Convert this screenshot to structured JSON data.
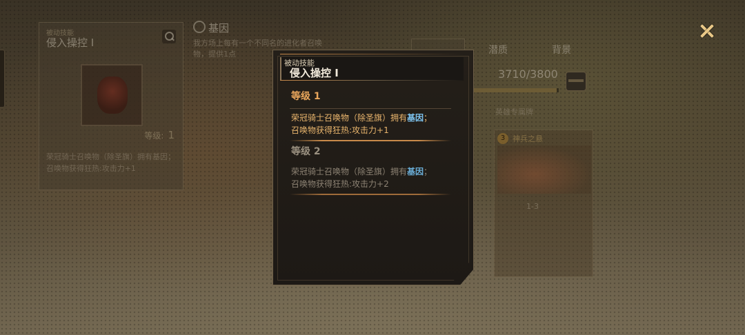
{
  "background": {
    "skill_card": {
      "category": "被动技能",
      "name": "侵入操控 I",
      "level_label": "等级:",
      "level_value": "1",
      "description": "荣冠骑士召唤物（除圣旗）拥有基因；召唤物获得狂热:攻击力+1"
    },
    "gene": {
      "title": "基因",
      "description": "我方场上每有一个不同名的进化者召唤物，提供1点"
    },
    "tabs": [
      "潜质",
      "背景"
    ],
    "exp": {
      "text": "3710/3800",
      "current": 3710,
      "max": 3800
    },
    "gear_caption": "英雄专属牌",
    "gear_card": {
      "cost": "3",
      "name": "神兵之悬",
      "ratio": "1-3"
    }
  },
  "close_icon": "close-icon",
  "tooltip": {
    "category": "被动技能",
    "title": "侵入操控 I",
    "levels": [
      {
        "header": "等级 1",
        "line1_pre": "荣冠骑士召唤物（除圣旗）拥有",
        "line1_kw": "基因",
        "line1_post": "；",
        "line2": "召唤物获得狂热:攻击力+1"
      },
      {
        "header": "等级 2",
        "line1_pre": "荣冠骑士召唤物（除圣旗）拥有",
        "line1_kw": "基因",
        "line1_post": "；",
        "line2": "召唤物获得狂热:攻击力+2"
      }
    ]
  },
  "colors": {
    "active_level": "#e9a65c",
    "inactive_level": "#9a9080",
    "keyword": "#7ec4f0",
    "close": "#e9c887"
  }
}
